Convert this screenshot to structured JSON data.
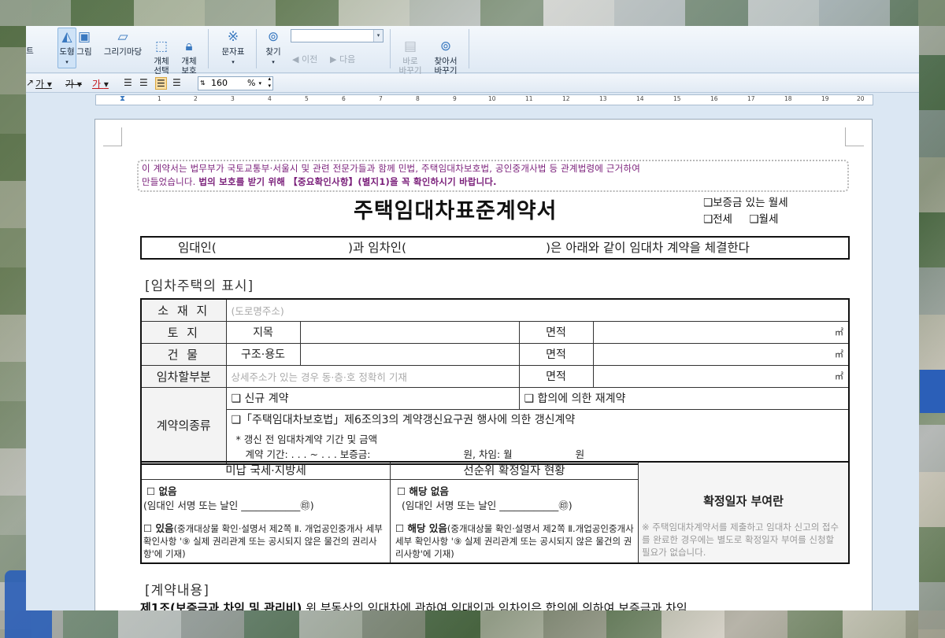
{
  "ribbon": {
    "tools": [
      {
        "label": "도형",
        "icon": "shape-icon"
      },
      {
        "label": "그림",
        "icon": "picture-icon"
      },
      {
        "label": "그리기마당",
        "icon": "drawing-gallery-icon"
      },
      {
        "label": "개체\n선택",
        "icon": "object-select-icon"
      },
      {
        "label": "개체\n보호",
        "icon": "object-protect-icon"
      },
      {
        "label": "문자표",
        "icon": "symbol-icon"
      },
      {
        "label": "찾기",
        "icon": "binoculars-icon"
      },
      {
        "label": "바로\n바꾸기",
        "icon": "replace-icon"
      },
      {
        "label": "찾아서\n바꾸기",
        "icon": "find-replace-icon"
      }
    ],
    "prev_label": "이전",
    "next_label": "다음",
    "left_partial": "트"
  },
  "format": {
    "zoom_value": "160",
    "zoom_unit": "%",
    "glyphs": [
      "가",
      "가",
      "가"
    ]
  },
  "ruler": {
    "ticks": [
      "1",
      "2",
      "3",
      "4",
      "5",
      "6",
      "7",
      "8",
      "9",
      "10",
      "11",
      "12",
      "13",
      "14",
      "15",
      "16",
      "17",
      "18",
      "19",
      "20"
    ]
  },
  "document": {
    "notice_line1": "이 계약서는 법무부가 국토교통부·서울시 및 관련 전문가들과 함께 민법, 주택임대차보호법, 공인중개사법 등 관계법령에 근거하여",
    "notice_line2a": "만들었습니다.",
    "notice_line2b": "법의 보호를 받기 위해 【중요확인사항】(별지1)을 꼭 확인하시기 바랍니다.",
    "title": "주택임대차표준계약서",
    "type_opt1": "❑보증금 있는 월세",
    "type_opt2": "❑전세",
    "type_opt3": "❑월세",
    "party_lessor": "임대인(",
    "party_mid": ")과 임차인(",
    "party_end": ")은 아래와 같이 임대차 계약을 체결한다",
    "section1": "[임차주택의 표시]",
    "row_location": "소 재 지",
    "row_location_ph": "(도로명주소)",
    "row_land": "토    지",
    "row_land_sub": "지목",
    "row_building": "건    물",
    "row_building_sub": "구조·용도",
    "row_part": "임차할부분",
    "row_part_ph": "상세주소가 있는 경우 동·층·호 정확히 기재",
    "area_label": "면적",
    "area_unit": "㎡",
    "contract_type": "계약의종류",
    "opt_new": "❑ 신규 계약",
    "opt_renew": "❑ 합의에 의한 재계약",
    "opt_right": "❑「주택임대차보호법」제6조의3의 계약갱신요구권 행사에 의한 갱신계약",
    "prev_contract": "* 갱신 전 임대차계약 기간 및 금액",
    "prev_period": "계약 기간:     .     .     . ~      .     .     .   보증금:",
    "prev_won": "원,  차임: 월",
    "prev_won2": "원",
    "tax_head": "미납 국세·지방세",
    "tax_none": "☐ 없음",
    "tax_sign": "(임대인 서명 또는 날인 ____________㊞)",
    "tax_has": "☐ 있음",
    "tax_has_note": "(중개대상물 확인·설명서 제2쪽 Ⅱ. 개업공인중개사 세부 확인사항 '⑨ 실제 권리관계 또는 공시되지 않은 물건의 권리사항'에 기재)",
    "prior_head": "선순위 확정일자 현황",
    "prior_none": "☐ 해당 없음",
    "prior_sign": "(임대인 서명 또는 날인 ____________㊞)",
    "prior_has": "☐ 해당 있음",
    "prior_has_note": "(중개대상물 확인·설명서 제2쪽 Ⅱ.개업공인중개사 세부 확인사항 '⑨ 실제 권리관계 또는 공시되지 않은 물건의 권리사항'에 기재)",
    "fix_head": "확정일자 부여란",
    "fix_note": "※ 주택임대차계약서를 제출하고 임대차 신고의 접수를 완료한 경우에는 별도로 확정일자 부여를 신청할 필요가 없습니다.",
    "section2": "[계약내용]",
    "clause1_title": "제1조(보증금과 차임 및 관리비)",
    "clause1_text": " 위 부동산의 임대차에 관하여 임대인과 임차인은 합의에 의하여 보증금과 차임"
  }
}
